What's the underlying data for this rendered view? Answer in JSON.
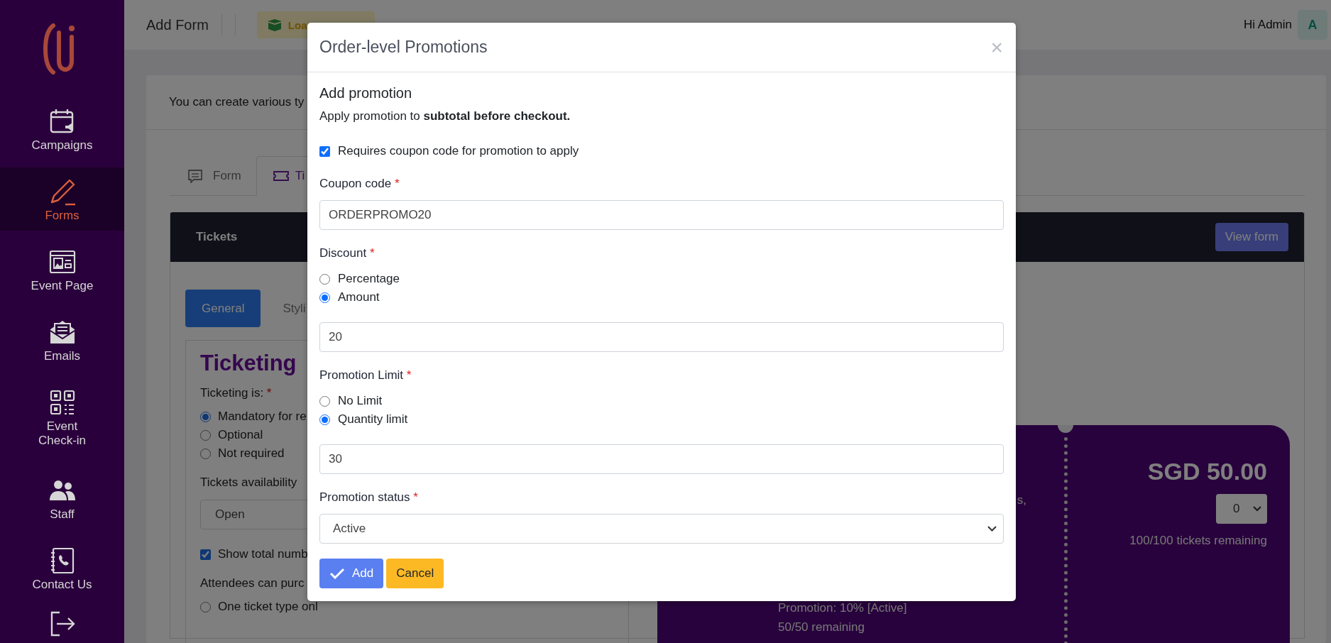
{
  "sidebar": {
    "items": [
      {
        "label": "Campaigns",
        "selected": false
      },
      {
        "label": "Forms",
        "selected": true
      },
      {
        "label": "Event Page",
        "selected": false
      },
      {
        "label": "Emails",
        "selected": false
      },
      {
        "label": "Event Check-in",
        "selected": false
      },
      {
        "label": "Staff",
        "selected": false
      },
      {
        "label": "Contact Us",
        "selected": false
      }
    ]
  },
  "topbar": {
    "title": "Add Form",
    "load_template": "Loa",
    "greeting": "Hi Admin",
    "avatar": "A"
  },
  "page": {
    "intro": "You can create various ty",
    "tabs": [
      {
        "label": "Form",
        "selected": false
      },
      {
        "label": "Ti",
        "selected": true
      }
    ],
    "tickets_header": {
      "title": "Tickets",
      "view_form": "View form"
    },
    "subtabs": [
      {
        "label": "General",
        "selected": true
      },
      {
        "label": "Styli",
        "selected": false
      }
    ],
    "settings": {
      "heading": "Ticketing",
      "ticketing_label": "Ticketing is:",
      "required_mark": "*",
      "ticketing_options": [
        {
          "label": "Mandatory for re",
          "selected": true
        },
        {
          "label": "Optional",
          "selected": false
        },
        {
          "label": "Not required",
          "selected": false
        }
      ],
      "availability_label": "Tickets availability",
      "availability_value": "Open",
      "show_total": {
        "label": "Show total numb",
        "checked": true
      },
      "purchase_label": "Attendees can purc",
      "purchase_options": [
        {
          "label": "One ticket type onl",
          "selected": false
        }
      ]
    },
    "ticket_card": {
      "fragment": "s,",
      "promotion": "Promotion: 10% [Active]",
      "remaining": "50/50 remaining",
      "price": "SGD 50.00",
      "quantity": "0",
      "tickets_remaining": "100/100 tickets remaining"
    }
  },
  "modal": {
    "title": "Order-level Promotions",
    "close": "×",
    "heading": "Add promotion",
    "description": "Apply promotion to **subtotal before checkout.**",
    "coupon_required": {
      "label": "Requires coupon code for promotion to apply",
      "checked": true
    },
    "coupon": {
      "label": "Coupon code",
      "required_mark": "*",
      "value": "ORDERPROMO20"
    },
    "discount": {
      "label": "Discount",
      "required_mark": "*",
      "options": [
        {
          "label": "Percentage",
          "selected": false
        },
        {
          "label": "Amount",
          "selected": true
        }
      ],
      "value": "20"
    },
    "limit": {
      "label": "Promotion Limit",
      "required_mark": "*",
      "options": [
        {
          "label": "No Limit",
          "selected": false
        },
        {
          "label": "Quantity limit",
          "selected": true
        }
      ],
      "value": "30"
    },
    "status": {
      "label": "Promotion status",
      "required_mark": "*",
      "value": "Active"
    },
    "buttons": [
      {
        "label": "Add",
        "kind": "primary"
      },
      {
        "label": "Cancel",
        "kind": "warning"
      }
    ]
  }
}
